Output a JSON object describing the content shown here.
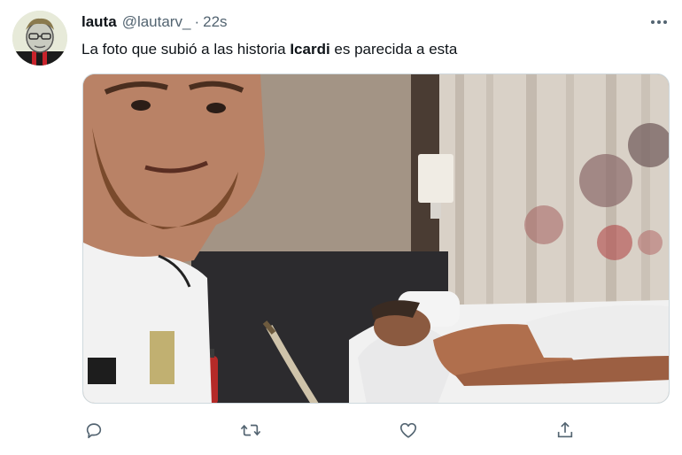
{
  "tweet": {
    "author_name": "lauta",
    "handle": "@lautarv_",
    "separator": "·",
    "time": "22s",
    "text_before": "La foto que subió a las historia ",
    "text_bold": "Icardi",
    "text_after": " es parecida a esta"
  },
  "icons": {
    "more": "more-horizontal-icon",
    "reply": "reply-icon",
    "retweet": "retweet-icon",
    "like": "heart-icon",
    "share": "share-icon"
  },
  "colors": {
    "text_primary": "#0f1419",
    "text_secondary": "#536471",
    "border": "#cfd9de"
  }
}
